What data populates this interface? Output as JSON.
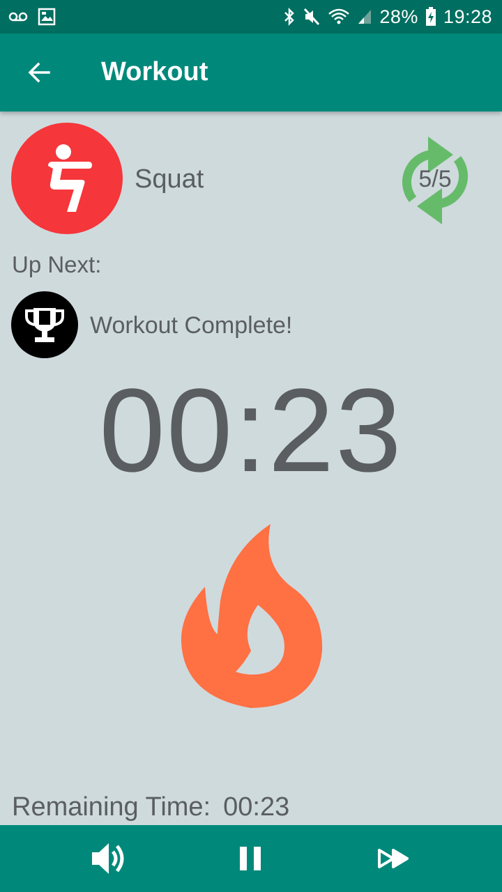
{
  "status_bar": {
    "battery": "28%",
    "time": "19:28",
    "icons": [
      "voicemail-icon",
      "gallery-icon",
      "bluetooth-icon",
      "mute-icon",
      "wifi-icon",
      "signal-icon",
      "battery-charging-icon"
    ]
  },
  "app_bar": {
    "title": "Workout",
    "back_icon": "arrow-left-icon"
  },
  "current_exercise": {
    "name": "Squat",
    "icon": "squat-icon",
    "icon_bg": "#f5363a",
    "rounds": "5/5",
    "rounds_icon": "repeat-icon",
    "rounds_color": "#66bb6a"
  },
  "up_next": {
    "label": "Up Next:",
    "name": "Workout Complete!",
    "icon": "trophy-icon"
  },
  "timer": "00:23",
  "flame": {
    "icon": "flame-icon",
    "color": "#ff7043"
  },
  "remaining": {
    "label": "Remaining Time:",
    "value": "00:23"
  },
  "controls": {
    "sound_icon": "volume-icon",
    "pause_icon": "pause-icon",
    "skip_icon": "fast-forward-icon"
  },
  "colors": {
    "primary": "#00897b",
    "primary_dark": "#006e60",
    "background": "#cfdadd",
    "text": "#5a5e60"
  }
}
